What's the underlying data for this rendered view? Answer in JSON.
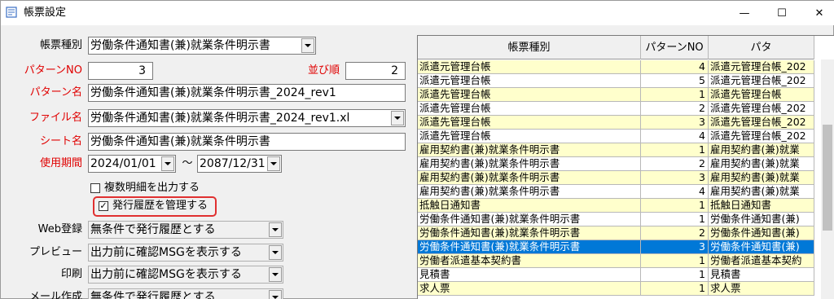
{
  "window": {
    "title": "帳票設定",
    "minimize": "—",
    "maximize": "☐",
    "close": "✕",
    "icon": "form-icon"
  },
  "form": {
    "report_type": {
      "label": "帳票種別",
      "value": "労働条件通知書(兼)就業条件明示書"
    },
    "pattern_no": {
      "label": "パターンNO",
      "value": "3"
    },
    "order": {
      "label": "並び順",
      "value": "2"
    },
    "pattern_name": {
      "label": "パターン名",
      "value": "労働条件通知書(兼)就業条件明示書_2024_rev1"
    },
    "file_name": {
      "label": "ファイル名",
      "value": "労働条件通知書(兼)就業条件明示書_2024_rev1.xl"
    },
    "sheet_name": {
      "label": "シート名",
      "value": "労働条件通知書(兼)就業条件明示書"
    },
    "period": {
      "label": "使用期間",
      "from": "2024/01/01",
      "separator": "～",
      "to": "2087/12/31"
    },
    "multi_detail": {
      "label": "複数明細を出力する",
      "checked": false
    },
    "manage_history": {
      "label": "発行履歴を管理する",
      "checked": true,
      "mark": "✓"
    },
    "web_register": {
      "label": "Web登録",
      "value": "無条件で発行履歴とする"
    },
    "preview": {
      "label": "プレビュー",
      "value": "出力前に確認MSGを表示する"
    },
    "print": {
      "label": "印刷",
      "value": "出力前に確認MSGを表示する"
    },
    "mail": {
      "label": "メール作成",
      "value": "無条件で発行履歴とする"
    }
  },
  "grid": {
    "headers": [
      "帳票種別",
      "パターンNO",
      "パタ"
    ],
    "rows": [
      {
        "type": "派遣元管理台帳",
        "no": "4",
        "name": "派遣元管理台帳_202",
        "style": "yellow"
      },
      {
        "type": "派遣元管理台帳",
        "no": "5",
        "name": "派遣元管理台帳_202",
        "style": "white"
      },
      {
        "type": "派遣先管理台帳",
        "no": "1",
        "name": "派遣先管理台帳",
        "style": "yellow"
      },
      {
        "type": "派遣先管理台帳",
        "no": "2",
        "name": "派遣先管理台帳_202",
        "style": "white"
      },
      {
        "type": "派遣先管理台帳",
        "no": "3",
        "name": "派遣先管理台帳_202",
        "style": "yellow"
      },
      {
        "type": "派遣先管理台帳",
        "no": "4",
        "name": "派遣先管理台帳_202",
        "style": "white"
      },
      {
        "type": "雇用契約書(兼)就業条件明示書",
        "no": "1",
        "name": "雇用契約書(兼)就業",
        "style": "yellow"
      },
      {
        "type": "雇用契約書(兼)就業条件明示書",
        "no": "2",
        "name": "雇用契約書(兼)就業",
        "style": "white"
      },
      {
        "type": "雇用契約書(兼)就業条件明示書",
        "no": "3",
        "name": "雇用契約書(兼)就業",
        "style": "yellow"
      },
      {
        "type": "雇用契約書(兼)就業条件明示書",
        "no": "4",
        "name": "雇用契約書(兼)就業",
        "style": "white"
      },
      {
        "type": "抵触日通知書",
        "no": "1",
        "name": "抵触日通知書",
        "style": "yellow"
      },
      {
        "type": "労働条件通知書(兼)就業条件明示書",
        "no": "1",
        "name": "労働条件通知書(兼)",
        "style": "white"
      },
      {
        "type": "労働条件通知書(兼)就業条件明示書",
        "no": "2",
        "name": "労働条件通知書(兼)",
        "style": "yellow"
      },
      {
        "type": "労働条件通知書(兼)就業条件明示書",
        "no": "3",
        "name": "労働条件通知書(兼)",
        "style": "selected"
      },
      {
        "type": "労働者派遣基本契約書",
        "no": "1",
        "name": "労働者派遣基本契約",
        "style": "yellow"
      },
      {
        "type": "見積書",
        "no": "1",
        "name": "見積書",
        "style": "white"
      },
      {
        "type": "求人票",
        "no": "1",
        "name": "求人票",
        "style": "yellow"
      }
    ]
  },
  "colors": {
    "yellow_row": "#ffffcc",
    "white_row": "#ffffff",
    "selected_row": "#0078d7",
    "required_label": "#e00000",
    "highlight": "#e03030"
  }
}
